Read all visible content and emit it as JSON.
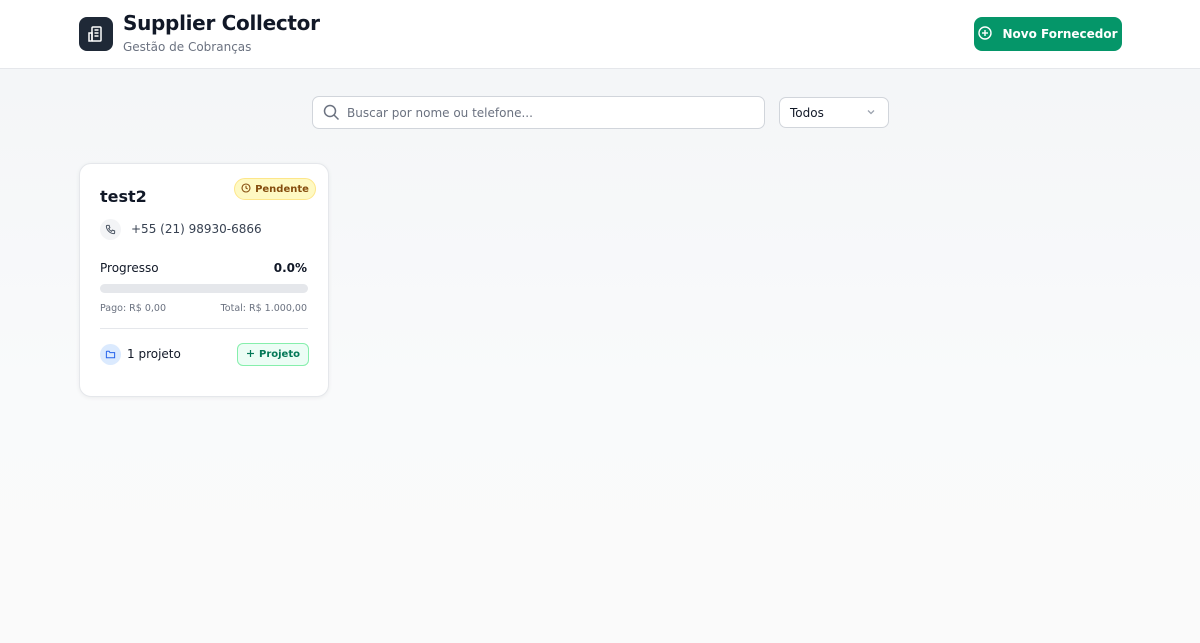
{
  "header": {
    "title": "Supplier Collector",
    "subtitle": "Gestão de Cobranças",
    "logo_icon": "building-icon",
    "new_button_label": "Novo Fornecedor",
    "new_button_icon": "plus-circle-icon",
    "accent_color": "#059669"
  },
  "search": {
    "placeholder": "Buscar por nome ou telefone...",
    "value": ""
  },
  "filter": {
    "selected": "Todos"
  },
  "suppliers": [
    {
      "name": "test2",
      "status": "Pendente",
      "status_color": "#fef9c3",
      "phone": "+55 (21) 98930-6866",
      "progress_label": "Progresso",
      "progress_text": "0.0%",
      "progress_fraction": 0.0,
      "paid": "Pago: R$ 0,00",
      "total": "Total: R$ 1.000,00",
      "projects": "1 projeto",
      "add_project_label": "Projeto"
    }
  ]
}
